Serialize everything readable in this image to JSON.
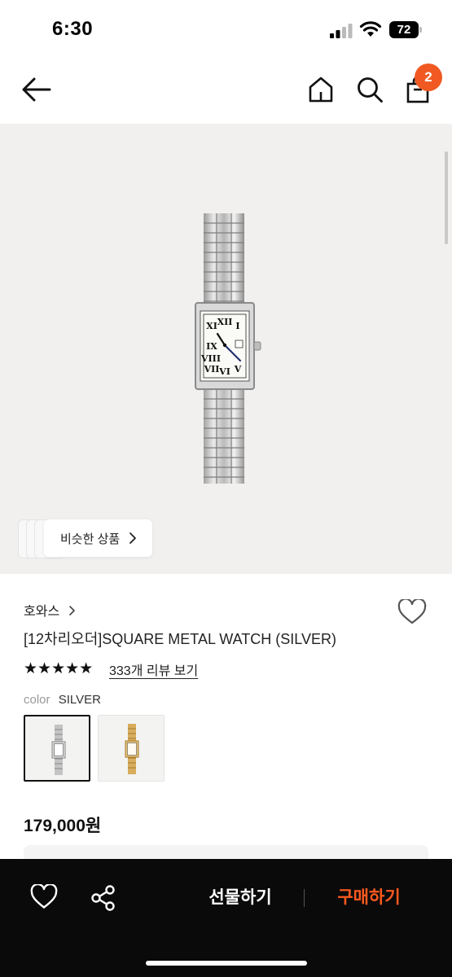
{
  "status_bar": {
    "time": "6:30",
    "battery": "72"
  },
  "header": {
    "cart_count": "2",
    "icons": [
      "back-arrow-icon",
      "home-icon",
      "search-icon",
      "shopping-bag-icon"
    ]
  },
  "gallery": {
    "similar_label": "비슷한 상품"
  },
  "product": {
    "brand": "호와스",
    "title": "[12차리오더]SQUARE METAL WATCH (SILVER)",
    "rating_stars": "★★★★★",
    "review_link": "333개 리뷰 보기",
    "color_label": "color",
    "color_value": "SILVER",
    "options": [
      {
        "name": "silver",
        "selected": true
      },
      {
        "name": "gold",
        "selected": false
      }
    ],
    "price": "179,000원"
  },
  "bottom_bar": {
    "gift_label": "선물하기",
    "buy_label": "구매하기"
  },
  "colors": {
    "accent": "#ff5a1f",
    "badge": "#f05a22",
    "bottom_bar": "#0a0a0a",
    "image_bg": "#f1f0ef"
  }
}
